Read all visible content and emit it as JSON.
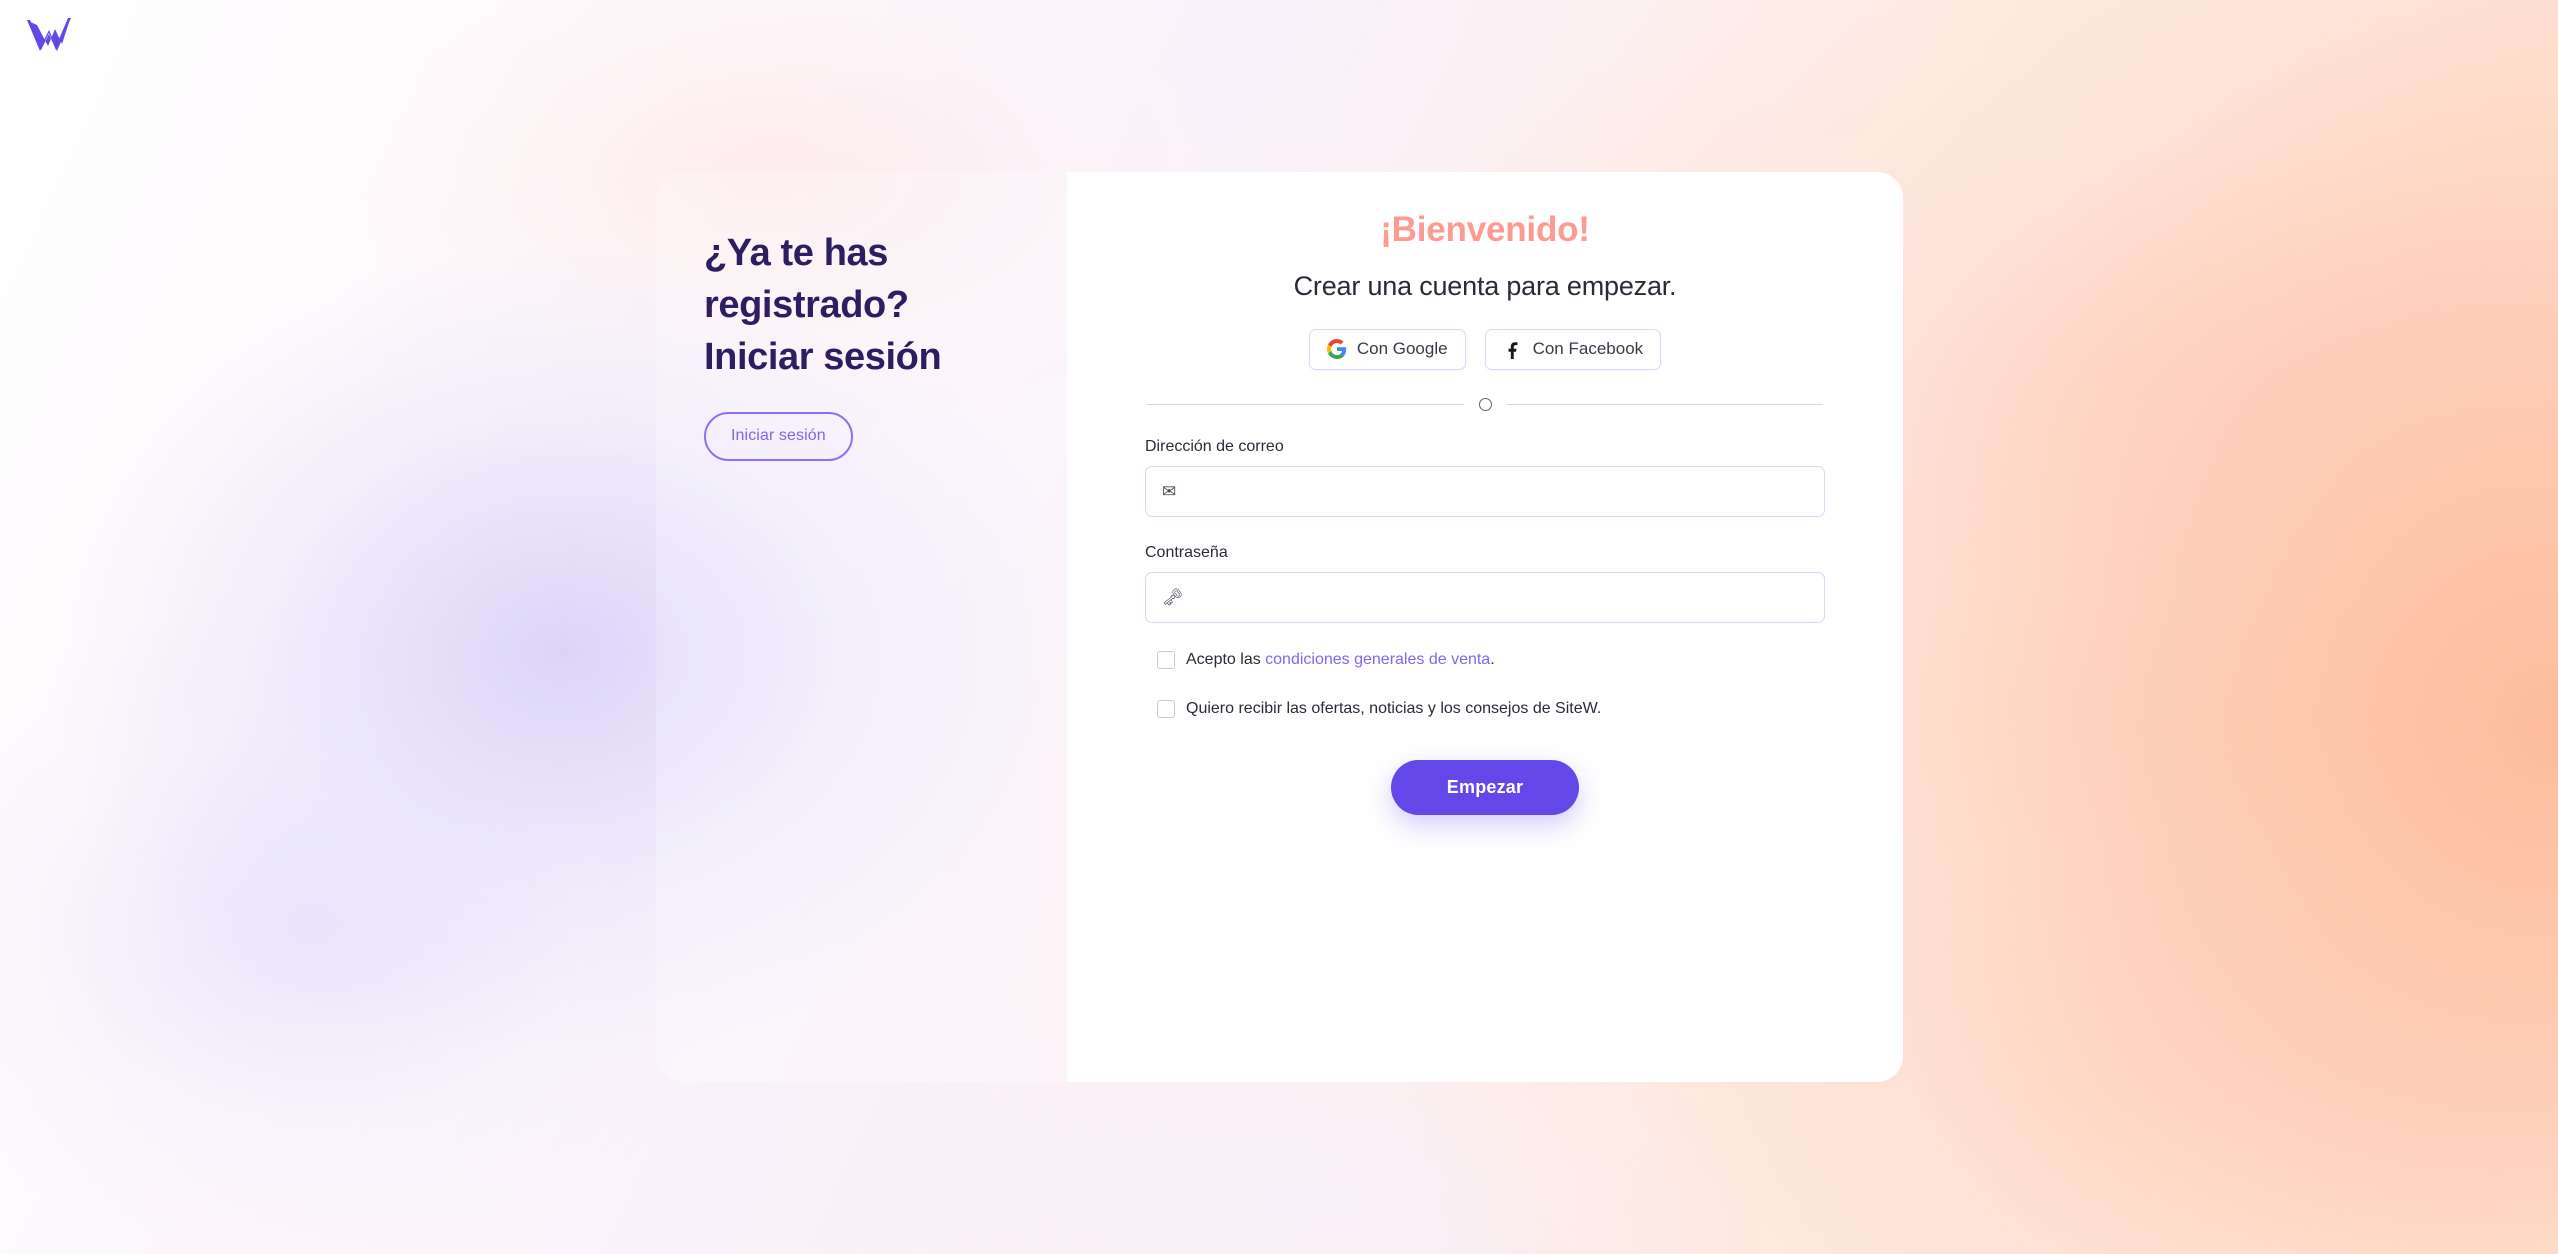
{
  "brand": {
    "logo_icon": "sitew-w-logo",
    "logo_color": "#6347e8",
    "name": "SiteW"
  },
  "colors": {
    "primary": "#6347e8",
    "primary_light": "#8166ef",
    "heading_dark": "#2d1e62",
    "welcome_coral": "#fd9a91",
    "card_bg": "#ffffff",
    "input_border": "#ddd6f7"
  },
  "left_panel": {
    "heading": "¿Ya te has registrado? Iniciar sesión",
    "login_button": "Iniciar sesión"
  },
  "signup_card": {
    "title": "¡Bienvenido!",
    "subtitle": "Crear una cuenta para empezar.",
    "social": [
      {
        "label": "Con Google",
        "icon": "google-icon"
      },
      {
        "label": "Con Facebook",
        "icon": "facebook-icon"
      }
    ],
    "divider_icon": "circle-divider-icon",
    "email_field": {
      "label": "Dirección de correo",
      "value": "",
      "placeholder": "",
      "icon": "envelope-icon"
    },
    "password_field": {
      "label": "Contraseña",
      "value": "",
      "placeholder": "",
      "icon": "key-icon"
    },
    "terms_checkbox": {
      "checked": false,
      "text_before": "Acepto las ",
      "link_text": "condiciones generales de venta",
      "text_after": "."
    },
    "newsletter_checkbox": {
      "checked": false,
      "text": "Quiero recibir las ofertas, noticias y los consejos de SiteW."
    },
    "submit_button": "Empezar"
  }
}
